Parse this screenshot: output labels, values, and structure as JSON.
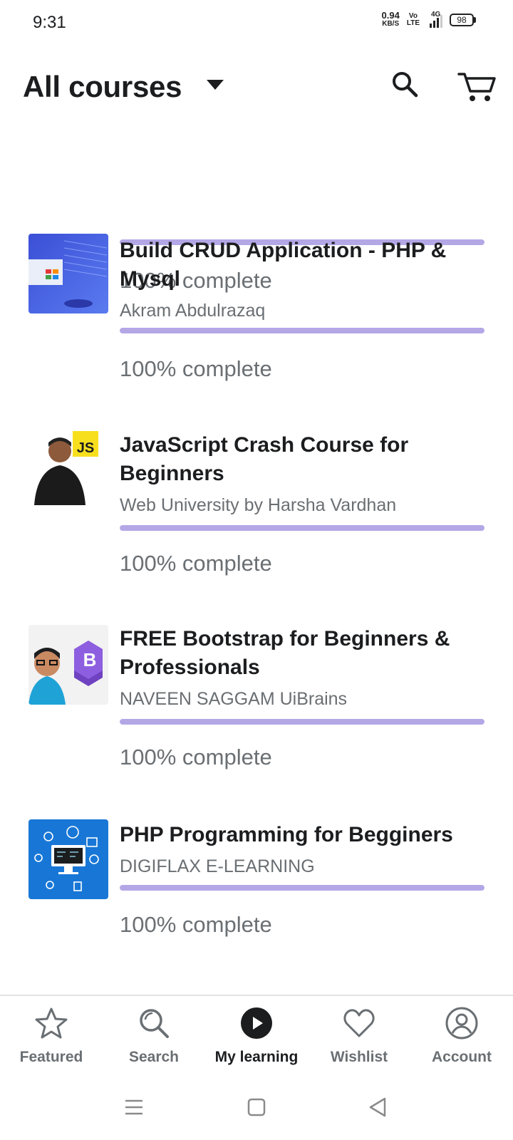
{
  "status_bar": {
    "time": "9:31",
    "net_speed_value": "0.94",
    "net_speed_unit": "KB/S",
    "volte_top": "Vo",
    "volte_bottom": "LTE",
    "network": "4G",
    "battery": "98"
  },
  "header": {
    "title": "All courses"
  },
  "courses": [
    {
      "title": "",
      "author": "",
      "progress": 1.0,
      "complete_label": "100% complete"
    },
    {
      "title": "Build CRUD Application - PHP & Mysql",
      "author": "Akram Abdulrazaq",
      "progress": 1.0,
      "complete_label": "100% complete",
      "thumb_badge": ""
    },
    {
      "title": "JavaScript Crash Course for Beginners",
      "author": "Web University by Harsha Vardhan",
      "progress": 1.0,
      "complete_label": "100% complete",
      "thumb_badge": "JS"
    },
    {
      "title": "FREE Bootstrap for Beginners & Professionals",
      "author": "NAVEEN SAGGAM UiBrains",
      "progress": 1.0,
      "complete_label": "100% complete",
      "thumb_badge": "B"
    },
    {
      "title": "PHP Programming for Begginers",
      "author": "DIGIFLAX E-LEARNING",
      "progress": 1.0,
      "complete_label": "100% complete",
      "thumb_badge": ""
    }
  ],
  "bottom_nav": {
    "items": [
      {
        "label": "Featured",
        "icon": "star-icon"
      },
      {
        "label": "Search",
        "icon": "search-icon"
      },
      {
        "label": "My learning",
        "icon": "play-circle-icon",
        "active": true
      },
      {
        "label": "Wishlist",
        "icon": "heart-icon"
      },
      {
        "label": "Account",
        "icon": "account-circle-icon"
      }
    ]
  },
  "colors": {
    "progress_fill": "#b4a7e6",
    "text_primary": "#1c1d1f",
    "text_secondary": "#6a6f73"
  }
}
